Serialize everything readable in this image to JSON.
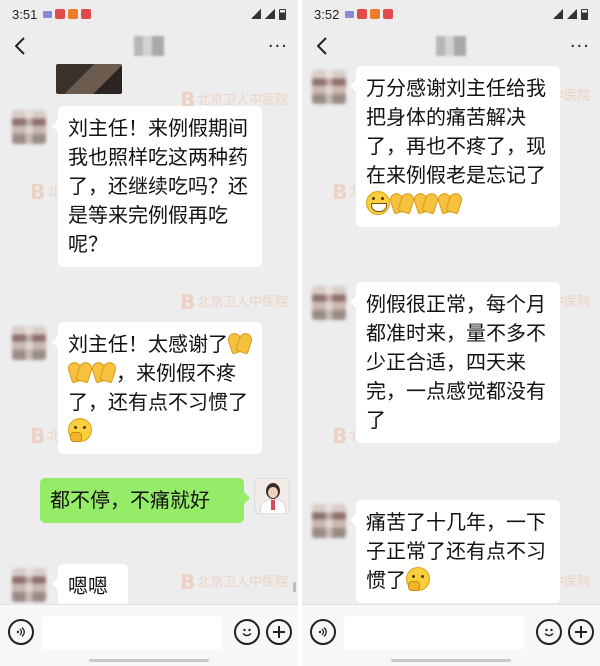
{
  "left": {
    "status": {
      "time": "3:51"
    },
    "icons": {
      "back": "back-arrow-icon",
      "more": "more-icon",
      "voice": "voice-icon",
      "emoji": "emoji-icon",
      "plus": "plus-icon"
    },
    "more_label": "···",
    "messages": [
      {
        "from": "patient",
        "text": "刘主任！来例假期间我也照样吃这两种药了，还继续吃吗？还是等来完例假再吃呢？"
      },
      {
        "from": "patient",
        "text_a": "刘主任！太感谢了",
        "text_b": "，来例假不疼了，还有点不习惯了"
      },
      {
        "from": "doctor",
        "text": "都不停，不痛就好"
      },
      {
        "from": "patient",
        "text": "嗯嗯"
      }
    ]
  },
  "right": {
    "status": {
      "time": "3:52"
    },
    "more_label": "···",
    "messages": [
      {
        "from": "patient",
        "text": "万分感谢刘主任给我把身体的痛苦解决了，再也不疼了，现在来例假老是忘记了"
      },
      {
        "from": "patient",
        "text": "例假很正常，每个月都准时来，量不多不少正合适，四天来完，一点感觉都没有了"
      },
      {
        "from": "patient",
        "text": "痛苦了十几年，一下子正常了还有点不习惯了"
      }
    ]
  },
  "watermark": {
    "text": "北京卫人中医院",
    "mark": "B"
  },
  "colors": {
    "chat_bg": "#ededed",
    "bubble_in": "#ffffff",
    "bubble_out": "#95ec69"
  }
}
